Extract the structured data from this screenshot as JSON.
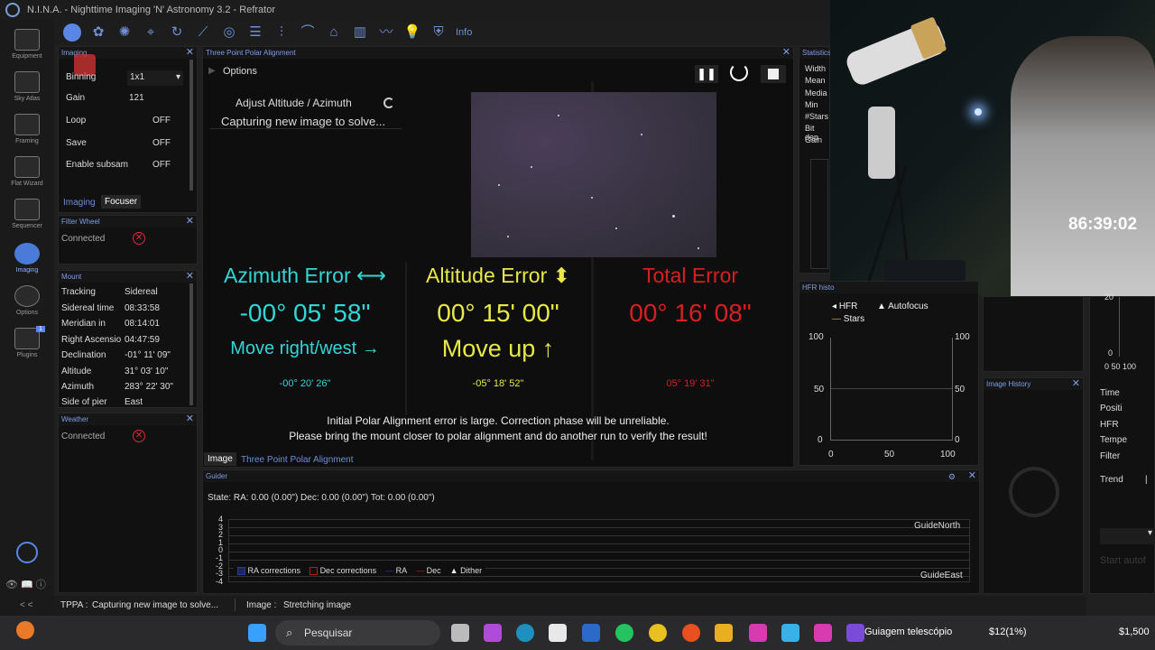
{
  "window": {
    "title": "N.I.N.A. - Nighttime Imaging 'N' Astronomy 3.2   -   Refrator"
  },
  "nav": [
    {
      "label": "Equipment"
    },
    {
      "label": "Sky Atlas"
    },
    {
      "label": "Framing"
    },
    {
      "label": "Flat Wizard"
    },
    {
      "label": "Sequencer"
    },
    {
      "label": "Imaging"
    },
    {
      "label": "Options"
    },
    {
      "label": "Plugins",
      "badge": "1"
    }
  ],
  "nav_bottom": {
    "collapse": "< <"
  },
  "toolbar": {
    "info_label": "Info"
  },
  "imaging_panel": {
    "title": "Imaging",
    "rows": [
      {
        "label": "Binning",
        "value": "1x1"
      },
      {
        "label": "Gain",
        "value": "121"
      },
      {
        "label": "Loop",
        "value": "OFF"
      },
      {
        "label": "Save",
        "value": "OFF"
      },
      {
        "label": "Enable subsam",
        "value": "OFF"
      }
    ],
    "tabs": [
      "Imaging",
      "Focuser"
    ]
  },
  "filter_wheel": {
    "title": "Filter Wheel",
    "status": "Connected"
  },
  "mount": {
    "title": "Mount",
    "rows": [
      {
        "label": "Tracking",
        "value": "Sidereal"
      },
      {
        "label": "Sidereal time",
        "value": "08:33:58"
      },
      {
        "label": "Meridian in",
        "value": "08:14:01"
      },
      {
        "label": "Right Ascensio",
        "value": "04:47:59"
      },
      {
        "label": "Declination",
        "value": "-01° 11' 09\""
      },
      {
        "label": "Altitude",
        "value": "31° 03' 10\""
      },
      {
        "label": "Azimuth",
        "value": "283° 22' 30\""
      },
      {
        "label": "Side of pier",
        "value": "East"
      }
    ]
  },
  "weather": {
    "title": "Weather",
    "status": "Connected"
  },
  "tppa": {
    "title": "Three Point Polar Alignment",
    "options_label": "Options",
    "step_title": "Adjust Altitude / Azimuth",
    "step_status": "Capturing new image to solve...",
    "azimuth": {
      "header": "Azimuth Error ⟷",
      "value": "-00° 05' 58\"",
      "move": "Move right/west →",
      "initial": "-00° 20' 26\"",
      "color": "#33d6d6"
    },
    "altitude": {
      "header": "Altitude Error ⬍",
      "value": "00° 15' 00\"",
      "move": "Move up ↑",
      "initial": "-05° 18' 52\"",
      "color": "#e8e84a"
    },
    "total": {
      "header": "Total Error",
      "value": "00° 16' 08\"",
      "initial": "05° 19' 31\"",
      "color": "#d42020"
    },
    "warning_line1": "Initial Polar Alignment error is large. Correction phase will be unreliable.",
    "warning_line2": "Please bring the mount closer to polar alignment and do another run to verify the result!",
    "tabs": [
      "Image",
      "Three Point Polar Alignment"
    ]
  },
  "statistics": {
    "title": "Statistics",
    "rows": [
      "Width",
      "Mean",
      "Media",
      "Min",
      "#Stars",
      "Bit dep",
      "Gain"
    ]
  },
  "hfr_history": {
    "title": "HFR histo",
    "legend": [
      "HFR",
      "Autofocus",
      "Stars"
    ],
    "y_left": [
      "100",
      "50",
      "0"
    ],
    "y_right": [
      "100",
      "50",
      "0"
    ],
    "x": [
      "0",
      "50",
      "100"
    ]
  },
  "image_history": {
    "title": "Image History"
  },
  "right_panel": {
    "axis": [
      "20",
      "0",
      "0 50 100"
    ],
    "rows": [
      "Time",
      "Positi",
      "HFR",
      "Tempe",
      "Filter",
      "Trend"
    ],
    "trend_value": "|",
    "button": "Start autof"
  },
  "guider": {
    "title": "Guider",
    "state": "State:  RA: 0.00 (0.00\")  Dec: 0.00 (0.00\")  Tot: 0.00 (0.00\")",
    "y_ticks": [
      "4",
      "3",
      "2",
      "1",
      "0",
      "-1",
      "-2",
      "-3",
      "-4"
    ],
    "north_label": "GuideNorth",
    "east_label": "GuideEast",
    "legend": [
      "RA corrections",
      "Dec corrections",
      "RA",
      "Dec",
      "Dither"
    ]
  },
  "statusbar": {
    "items": [
      {
        "label": "TPPA :",
        "value": "Capturing new image to solve..."
      },
      {
        "label": "Image :",
        "value": "Stretching image"
      }
    ]
  },
  "webcam": {
    "timer": "86:39:02"
  },
  "taskbar": {
    "search": "Pesquisar",
    "active_app": "Guiagem telescópio",
    "badge1": "$12(1%)",
    "badge2": "$1,500"
  },
  "colors": {
    "accent": "#6f8fd6",
    "error_red": "#e02a3a"
  }
}
